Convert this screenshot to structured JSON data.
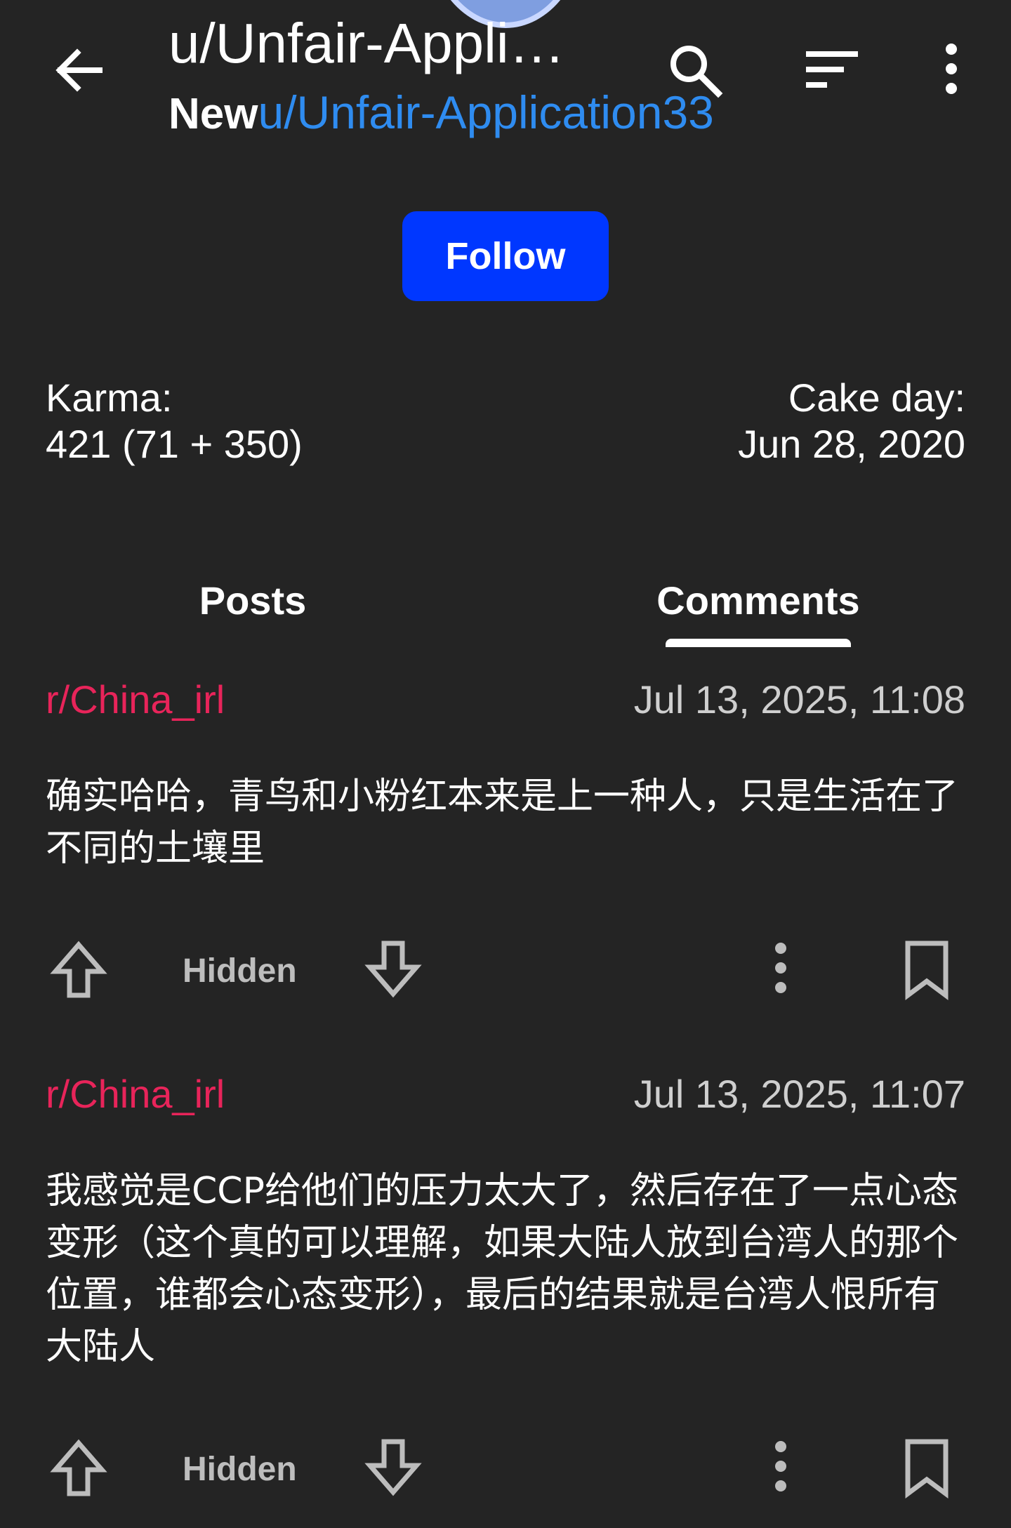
{
  "header": {
    "title": "u/Unfair-Appli…",
    "subtitle_sort": "New",
    "subtitle_user": "u/Unfair-Application33",
    "icons": [
      "back-arrow-icon",
      "search-icon",
      "sort-icon",
      "more-vert-icon"
    ]
  },
  "profile": {
    "follow_label": "Follow",
    "karma_label": "Karma:",
    "karma_value": "421 (71 + 350)",
    "cake_label": "Cake day:",
    "cake_value": "Jun 28, 2020"
  },
  "tabs": [
    {
      "label": "Posts",
      "active": false
    },
    {
      "label": "Comments",
      "active": true
    }
  ],
  "comments": [
    {
      "subreddit": "r/China_irl",
      "timestamp": "Jul 13, 2025, 11:08",
      "body": "确实哈哈，青鸟和小粉红本来是上一种人，只是生活在了不同的土壤里",
      "score": "Hidden"
    },
    {
      "subreddit": "r/China_irl",
      "timestamp": "Jul 13, 2025, 11:07",
      "body": "我感觉是CCP给他们的压力太大了，然后存在了一点心态变形（这个真的可以理解，如果大陆人放到台湾人的那个位置，谁都会心态变形），最后的结果就是台湾人恨所有大陆人",
      "score": "Hidden"
    }
  ],
  "colors": {
    "background": "#242424",
    "accent_blue": "#0037ff",
    "link_blue": "#2f8cf0",
    "subreddit_pink": "#e8245a"
  }
}
